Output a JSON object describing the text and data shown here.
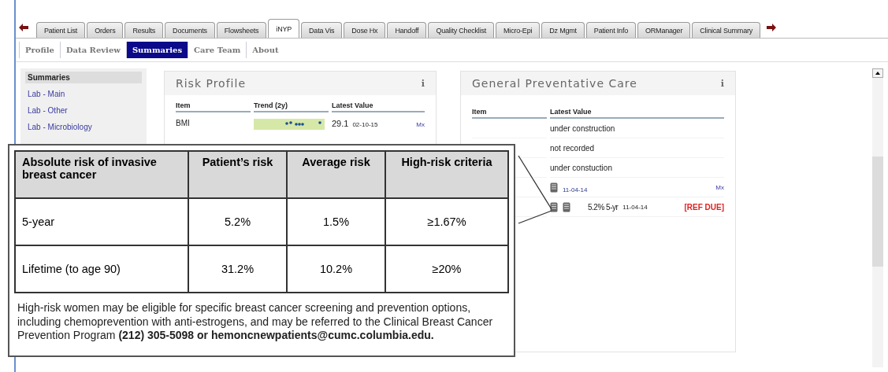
{
  "tabs": [
    {
      "label": "Patient List",
      "selected": false
    },
    {
      "label": "Orders",
      "selected": false
    },
    {
      "label": "Results",
      "selected": false
    },
    {
      "label": "Documents",
      "selected": false
    },
    {
      "label": "Flowsheets",
      "selected": false
    },
    {
      "label": "iNYP",
      "selected": true
    },
    {
      "label": "Data Vis",
      "selected": false
    },
    {
      "label": "Dose Hx",
      "selected": false
    },
    {
      "label": "Handoff",
      "selected": false
    },
    {
      "label": "Quality Checklist",
      "selected": false
    },
    {
      "label": "Micro-Epi",
      "selected": false
    },
    {
      "label": "Dz Mgmt",
      "selected": false
    },
    {
      "label": "Patient Info",
      "selected": false
    },
    {
      "label": "ORManager",
      "selected": false
    },
    {
      "label": "Clinical Summary",
      "selected": false
    }
  ],
  "subtabs": [
    {
      "label": "Profile",
      "selected": false
    },
    {
      "label": "Data Review",
      "selected": false
    },
    {
      "label": "Summaries",
      "selected": true
    },
    {
      "label": "Care Team",
      "selected": false
    },
    {
      "label": "About",
      "selected": false
    }
  ],
  "sidebar": {
    "items": [
      {
        "label": "Summaries",
        "selected": true
      },
      {
        "label": "Lab - Main",
        "selected": false
      },
      {
        "label": "Lab - Other",
        "selected": false
      },
      {
        "label": "Lab - Microbiology",
        "selected": false
      }
    ]
  },
  "risk_profile": {
    "title": "Risk Profile",
    "info": "i",
    "columns": [
      "Item",
      "Trend (2y)",
      "Latest Value"
    ],
    "rows": [
      {
        "item": "BMI",
        "value": "29.1",
        "date": "02-10-15",
        "link": "Mx"
      }
    ]
  },
  "preventative_care": {
    "title": "General Preventative Care",
    "info": "i",
    "columns": [
      "Item",
      "Latest Value"
    ],
    "rows": [
      {
        "kind": "text",
        "value": "under construction"
      },
      {
        "kind": "text",
        "value": "not recorded"
      },
      {
        "kind": "text",
        "value": "under constuction"
      },
      {
        "kind": "document",
        "date": "11-04-14",
        "link": "Mx"
      },
      {
        "kind": "risk",
        "value": "5.2% 5-yr",
        "date": "11-04-14",
        "flag": "[REF DUE]"
      }
    ]
  },
  "popup": {
    "columns": [
      "Absolute risk of invasive breast cancer",
      "Patient’s risk",
      "Average risk",
      "High-risk criteria"
    ],
    "rows": [
      [
        "5-year",
        "5.2%",
        "1.5%",
        "≥1.67%"
      ],
      [
        "Lifetime (to age 90)",
        "31.2%",
        "10.2%",
        "≥20%"
      ]
    ],
    "note": "High-risk women may be eligible for specific breast cancer screening and prevention options, including chemoprevention with anti-estrogens, and may be referred to the Clinical Breast Cancer Prevention Program **(212) 305-5098 or hemoncnewpatients@cumc.columbia.edu.**"
  }
}
